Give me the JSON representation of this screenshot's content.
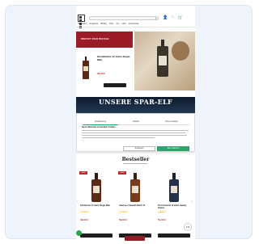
{
  "header": {
    "search_icon": "search-icon",
    "icons": [
      "user-icon",
      "heart-icon",
      "cart-icon"
    ],
    "icon_glyphs": [
      "👤",
      "♡",
      "🛒"
    ]
  },
  "nav": {
    "items": [
      "Neuheiten",
      "Angebote",
      "Whisky",
      "Rum",
      "Gin",
      "Likör",
      "Geschenke"
    ]
  },
  "hero": {
    "red_title": "WHISKY DER WOCHE",
    "product_title": "Glenallachie 12 Jahre Single Malt",
    "price": "29,90 €"
  },
  "banner": {
    "title": "UNSERE SPAR-ELF"
  },
  "cookie_dialog": {
    "tabs": [
      "Zustimmung",
      "Details",
      "Über Cookies"
    ],
    "heading": "Diese Webseite verwendet Cookies",
    "configure_label": "Anpassen",
    "accept_label": "Alle zulassen",
    "accent_color": "#2ea46a"
  },
  "section": {
    "title": "Bestseller"
  },
  "products": [
    {
      "badge": "SALE",
      "name": "Glenfarclas 15 Jahre Single Malt",
      "stars": "★★★★★",
      "price": "49,90 €",
      "color": "#5a2a15"
    },
    {
      "badge": "SALE",
      "name": "Aberlour A'bunadh Batch 72",
      "stars": "★★★★★",
      "price": "59,90 €",
      "color": "#7a3b1c"
    },
    {
      "badge": "",
      "name": "Port Charlotte 10 Jahre Heavily Peated",
      "stars": "★★★★☆",
      "price": "54,90 €",
      "color": "#23324a"
    }
  ],
  "trust_badge": "4,8",
  "brand_color": "#9b1b26"
}
